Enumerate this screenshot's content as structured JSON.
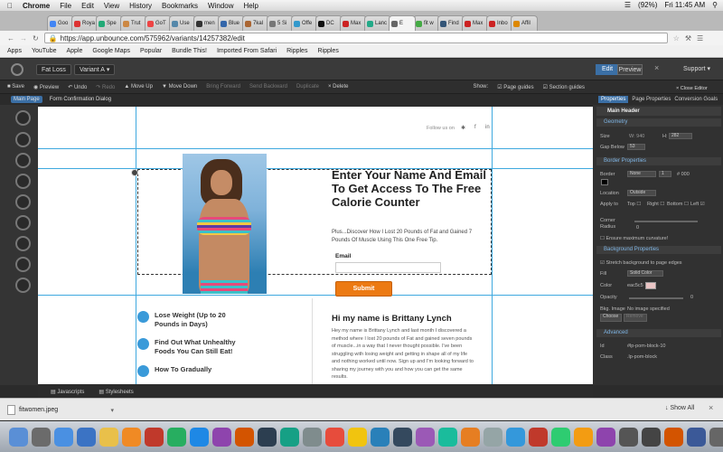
{
  "menubar": {
    "app": "Chrome",
    "items": [
      "File",
      "Edit",
      "View",
      "History",
      "Bookmarks",
      "Window",
      "Help"
    ],
    "battery": "(92%)",
    "clock": "Fri 11:45 AM"
  },
  "tabs": [
    "Goo",
    "Roya",
    "Spe",
    "Trut",
    "GoT",
    "Use",
    "men",
    "Blue",
    "7kal",
    "5 Si",
    "Offe",
    "DC",
    "Max",
    "Lanc",
    "E",
    "fit w",
    "Find",
    "Max",
    "Inbo",
    "Affil"
  ],
  "address": {
    "url": "https://app.unbounce.com/575962/variants/14257382/edit"
  },
  "bookmarks": [
    "Apps",
    "YouTube",
    "Apple",
    "Google Maps",
    "Popular",
    "Bundle This!",
    "Imported From Safari",
    "Ripples",
    "Ripples"
  ],
  "editor": {
    "page_name": "Fat Loss",
    "variant": "Variant A",
    "edit": "Edit",
    "preview": "Preview",
    "support": "Support"
  },
  "toolbar": {
    "save": "Save",
    "preview": "Preview",
    "undo": "Undo",
    "redo": "Redo",
    "move_up": "Move Up",
    "move_down": "Move Down",
    "bring_forward": "Bring Forward",
    "send_backward": "Send Backward",
    "duplicate": "Duplicate",
    "delete": "Delete",
    "show": "Show:",
    "page_guides": "Page guides",
    "section_guides": "Section guides"
  },
  "page_tabs": {
    "main": "Main Page",
    "confirm": "Form Confirmation Dialog"
  },
  "canvas": {
    "follow": "Follow us on",
    "heading": "Enter Your Name And Email To Get Access To The Free Calorie Counter",
    "subtext": "Plus...Discover How I Lost 20 Pounds of Fat and Gained 7 Pounds Of Muscle Using This One Free Tip.",
    "email_label": "Email",
    "submit": "Submit",
    "bullets": [
      "Lose Weight (Up to 20 Pounds in Days)",
      "Find Out What Unhealthy Foods You Can Still Eat!",
      "How To Gradually"
    ],
    "bio_title": "Hi my name is Brittany Lynch",
    "bio_text": "Hey my name is Brittany Lynch and last month I discovered a method where I lost 20 pounds of Fat and gained seven pounds of muscle...in a way that I never thought possible. I've been struggling with losing weight and getting in shape all of my life and nothing worked until now. Sign up and I'm looking forward to sharing my journey with you and how you can get the same results."
  },
  "panel": {
    "tabs": [
      "Properties",
      "Page Properties",
      "Conversion Goals"
    ],
    "close": "Close Editor",
    "title": "Main Header",
    "geometry": "Geometry",
    "size": "Size",
    "w": "W: 940",
    "h_label": "H:",
    "h": "282",
    "gap": "Gap Below",
    "gap_val": "53",
    "border_props": "Border Properties",
    "border": "Border",
    "border_style": "None",
    "border_width": "1",
    "border_color": "# 000",
    "location": "Location",
    "location_val": "Outside",
    "apply_to": "Apply to",
    "top": "Top",
    "right": "Right",
    "bottom": "Bottom",
    "left": "Left",
    "corner": "Corner",
    "radius": "Radius",
    "radius_val": "0",
    "ensure": "Ensure maximum curvature!",
    "bg_props": "Background Properties",
    "stretch": "Stretch background to page edges",
    "fill": "Fill",
    "fill_val": "Solid Color",
    "color": "Color",
    "color_val": "eac5c5",
    "opacity": "Opacity",
    "opacity_val": "0",
    "bkg_image": "Bkg. Image",
    "no_image": "No image specified",
    "choose": "Choose",
    "remove": "Remove",
    "advanced": "Advanced",
    "id": "Id",
    "id_val": "#lp-pom-block-10",
    "class": "Class",
    "class_val": ".lp-pom-block"
  },
  "footer": {
    "javascripts": "Javascripts",
    "stylesheets": "Stylesheets"
  },
  "download": {
    "file": "fitwomen.jpeg",
    "show_all": "Show All"
  },
  "colors": {
    "accent": "#3b6fa5",
    "guide": "#3fa9df",
    "submit": "#ec7a13"
  }
}
